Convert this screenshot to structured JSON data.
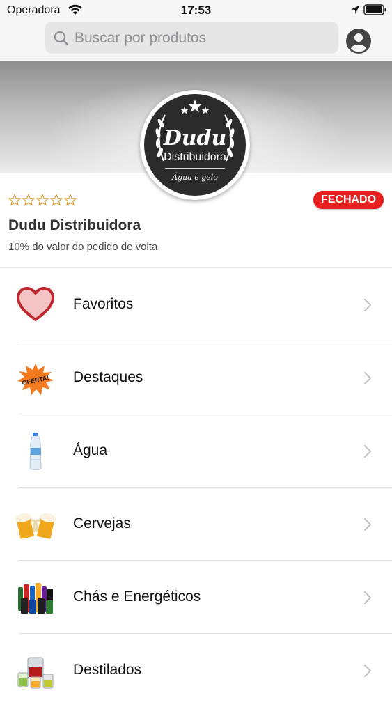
{
  "status_bar": {
    "carrier": "Operadora",
    "time": "17:53"
  },
  "search": {
    "placeholder": "Buscar por produtos"
  },
  "store": {
    "logo_name": "Dudu",
    "logo_subtitle": "Distribuidora",
    "logo_tagline": "Água e gelo",
    "rating_stars": 0,
    "status_badge": "FECHADO",
    "name": "Dudu Distribuidora",
    "cashback_text": "10% do valor do pedido de volta"
  },
  "categories": [
    {
      "label": "Favoritos",
      "icon": "heart-icon"
    },
    {
      "label": "Destaques",
      "icon": "oferta-burst-icon"
    },
    {
      "label": "Água",
      "icon": "water-bottle-icon"
    },
    {
      "label": "Cervejas",
      "icon": "beer-mugs-icon"
    },
    {
      "label": "Chás e Energéticos",
      "icon": "energy-drinks-icon"
    },
    {
      "label": "Destilados",
      "icon": "spirits-glasses-icon"
    }
  ],
  "colors": {
    "badge": "#e8201f",
    "star_outline": "#e0a030"
  }
}
